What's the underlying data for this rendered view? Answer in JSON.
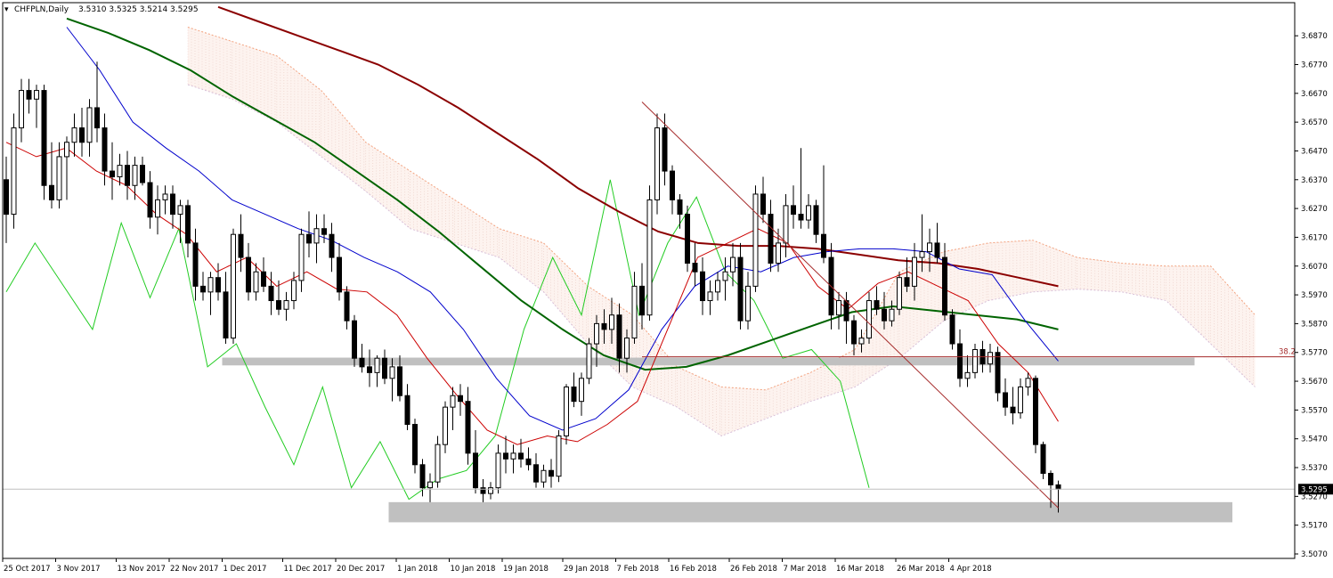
{
  "window": {
    "symbol_label": "CHFPLN,Daily",
    "ohlc_label": "3.5310 3.5325 3.5214 3.5295"
  },
  "colors": {
    "background": "#ffffff",
    "bull_candle": "#ffffff",
    "bear_candle": "#000000",
    "tenkan": "#cc0000",
    "kijun": "#0000cc",
    "chikou": "#22cc22",
    "ema50": "#006400",
    "ema100": "#8b0000",
    "cloud_top": "#f4a582",
    "cloud_bottom": "#d8bfd8",
    "support_zone": "#c0c0c0",
    "trendline": "#a52a2a",
    "fib_line": "#a52a2a",
    "price_tag_bg": "#000000",
    "price_tag_text": "#ffffff"
  },
  "chart_data": {
    "type": "candlestick",
    "ylim": [
      3.507,
      3.692
    ],
    "y_ticks": [
      "3.6870",
      "3.6770",
      "3.6670",
      "3.6570",
      "3.6470",
      "3.6370",
      "3.6270",
      "3.6170",
      "3.6070",
      "3.5970",
      "3.5870",
      "3.5770",
      "3.5670",
      "3.5570",
      "3.5470",
      "3.5370",
      "3.5270",
      "3.5170",
      "3.5070"
    ],
    "x_ticks": [
      "25 Oct 2017",
      "3 Nov 2017",
      "13 Nov 2017",
      "22 Nov 2017",
      "1 Dec 2017",
      "11 Dec 2017",
      "20 Dec 2017",
      "1 Jan 2018",
      "10 Jan 2018",
      "19 Jan 2018",
      "29 Jan 2018",
      "7 Feb 2018",
      "16 Feb 2018",
      "26 Feb 2018",
      "7 Mar 2018",
      "16 Mar 2018",
      "26 Mar 2018",
      "4 Apr 2018"
    ],
    "x_tick_index": [
      0,
      7,
      15,
      22,
      29,
      37,
      44,
      52,
      59,
      66,
      74,
      81,
      88,
      96,
      103,
      110,
      118,
      125
    ],
    "last_price": "3.5295",
    "fib_label": "38.2",
    "fib_level": 3.5755,
    "candles": [
      [
        3.637,
        3.645,
        3.615,
        3.625
      ],
      [
        3.625,
        3.66,
        3.62,
        3.655
      ],
      [
        3.655,
        3.672,
        3.65,
        3.668
      ],
      [
        3.668,
        3.672,
        3.66,
        3.665
      ],
      [
        3.665,
        3.67,
        3.655,
        3.668
      ],
      [
        3.668,
        3.67,
        3.63,
        3.635
      ],
      [
        3.635,
        3.65,
        3.627,
        3.63
      ],
      [
        3.63,
        3.65,
        3.627,
        3.645
      ],
      [
        3.645,
        3.652,
        3.63,
        3.65
      ],
      [
        3.65,
        3.66,
        3.645,
        3.655
      ],
      [
        3.655,
        3.662,
        3.645,
        3.65
      ],
      [
        3.65,
        3.665,
        3.645,
        3.662
      ],
      [
        3.662,
        3.678,
        3.65,
        3.655
      ],
      [
        3.655,
        3.66,
        3.635,
        3.64
      ],
      [
        3.64,
        3.65,
        3.63,
        3.638
      ],
      [
        3.638,
        3.646,
        3.635,
        3.642
      ],
      [
        3.642,
        3.647,
        3.63,
        3.635
      ],
      [
        3.635,
        3.645,
        3.63,
        3.642
      ],
      [
        3.642,
        3.645,
        3.635,
        3.636
      ],
      [
        3.636,
        3.64,
        3.62,
        3.624
      ],
      [
        3.624,
        3.635,
        3.618,
        3.63
      ],
      [
        3.63,
        3.635,
        3.625,
        3.632
      ],
      [
        3.632,
        3.635,
        3.62,
        3.625
      ],
      [
        3.625,
        3.63,
        3.615,
        3.628
      ],
      [
        3.628,
        3.63,
        3.61,
        3.615
      ],
      [
        3.615,
        3.62,
        3.595,
        3.6
      ],
      [
        3.6,
        3.605,
        3.595,
        3.598
      ],
      [
        3.598,
        3.605,
        3.59,
        3.603
      ],
      [
        3.603,
        3.608,
        3.595,
        3.598
      ],
      [
        3.598,
        3.605,
        3.58,
        3.582
      ],
      [
        3.582,
        3.62,
        3.58,
        3.618
      ],
      [
        3.618,
        3.625,
        3.605,
        3.61
      ],
      [
        3.61,
        3.615,
        3.595,
        3.598
      ],
      [
        3.598,
        3.608,
        3.595,
        3.605
      ],
      [
        3.605,
        3.61,
        3.598,
        3.6
      ],
      [
        3.6,
        3.605,
        3.59,
        3.595
      ],
      [
        3.595,
        3.602,
        3.59,
        3.592
      ],
      [
        3.592,
        3.598,
        3.588,
        3.595
      ],
      [
        3.595,
        3.605,
        3.592,
        3.602
      ],
      [
        3.602,
        3.62,
        3.598,
        3.618
      ],
      [
        3.618,
        3.626,
        3.61,
        3.615
      ],
      [
        3.615,
        3.625,
        3.608,
        3.62
      ],
      [
        3.62,
        3.625,
        3.615,
        3.618
      ],
      [
        3.618,
        3.622,
        3.605,
        3.61
      ],
      [
        3.61,
        3.615,
        3.595,
        3.598
      ],
      [
        3.598,
        3.6,
        3.585,
        3.588
      ],
      [
        3.588,
        3.59,
        3.572,
        3.575
      ],
      [
        3.575,
        3.58,
        3.57,
        3.572
      ],
      [
        3.572,
        3.578,
        3.565,
        3.57
      ],
      [
        3.57,
        3.576,
        3.565,
        3.575
      ],
      [
        3.575,
        3.578,
        3.566,
        3.568
      ],
      [
        3.568,
        3.575,
        3.56,
        3.572
      ],
      [
        3.572,
        3.576,
        3.56,
        3.562
      ],
      [
        3.562,
        3.566,
        3.55,
        3.552
      ],
      [
        3.552,
        3.554,
        3.535,
        3.538
      ],
      [
        3.538,
        3.54,
        3.527,
        3.53
      ],
      [
        3.53,
        3.535,
        3.525,
        3.532
      ],
      [
        3.532,
        3.548,
        3.53,
        3.545
      ],
      [
        3.545,
        3.56,
        3.542,
        3.558
      ],
      [
        3.558,
        3.565,
        3.55,
        3.562
      ],
      [
        3.562,
        3.566,
        3.555,
        3.56
      ],
      [
        3.56,
        3.565,
        3.538,
        3.542
      ],
      [
        3.542,
        3.55,
        3.528,
        3.53
      ],
      [
        3.53,
        3.533,
        3.525,
        3.528
      ],
      [
        3.528,
        3.532,
        3.526,
        3.53
      ],
      [
        3.53,
        3.545,
        3.528,
        3.542
      ],
      [
        3.542,
        3.548,
        3.535,
        3.54
      ],
      [
        3.54,
        3.545,
        3.535,
        3.542
      ],
      [
        3.542,
        3.547,
        3.537,
        3.54
      ],
      [
        3.54,
        3.544,
        3.536,
        3.538
      ],
      [
        3.538,
        3.542,
        3.53,
        3.532
      ],
      [
        3.532,
        3.538,
        3.53,
        3.536
      ],
      [
        3.536,
        3.54,
        3.53,
        3.534
      ],
      [
        3.534,
        3.55,
        3.532,
        3.548
      ],
      [
        3.548,
        3.566,
        3.545,
        3.565
      ],
      [
        3.565,
        3.57,
        3.558,
        3.56
      ],
      [
        3.56,
        3.57,
        3.555,
        3.568
      ],
      [
        3.568,
        3.582,
        3.566,
        3.58
      ],
      [
        3.58,
        3.59,
        3.572,
        3.587
      ],
      [
        3.587,
        3.592,
        3.58,
        3.585
      ],
      [
        3.585,
        3.596,
        3.58,
        3.59
      ],
      [
        3.59,
        3.594,
        3.57,
        3.575
      ],
      [
        3.575,
        3.585,
        3.57,
        3.582
      ],
      [
        3.582,
        3.605,
        3.58,
        3.6
      ],
      [
        3.6,
        3.608,
        3.585,
        3.59
      ],
      [
        3.59,
        3.635,
        3.588,
        3.63
      ],
      [
        3.63,
        3.66,
        3.625,
        3.655
      ],
      [
        3.655,
        3.66,
        3.635,
        3.64
      ],
      [
        3.64,
        3.642,
        3.625,
        3.63
      ],
      [
        3.63,
        3.632,
        3.62,
        3.625
      ],
      [
        3.625,
        3.628,
        3.605,
        3.608
      ],
      [
        3.608,
        3.615,
        3.6,
        3.605
      ],
      [
        3.605,
        3.61,
        3.59,
        3.595
      ],
      [
        3.595,
        3.602,
        3.59,
        3.598
      ],
      [
        3.598,
        3.605,
        3.595,
        3.602
      ],
      [
        3.602,
        3.61,
        3.595,
        3.605
      ],
      [
        3.605,
        3.615,
        3.6,
        3.61
      ],
      [
        3.61,
        3.615,
        3.585,
        3.588
      ],
      [
        3.588,
        3.605,
        3.585,
        3.6
      ],
      [
        3.6,
        3.635,
        3.598,
        3.632
      ],
      [
        3.632,
        3.638,
        3.622,
        3.625
      ],
      [
        3.625,
        3.63,
        3.605,
        3.608
      ],
      [
        3.608,
        3.62,
        3.605,
        3.615
      ],
      [
        3.615,
        3.632,
        3.61,
        3.628
      ],
      [
        3.628,
        3.635,
        3.62,
        3.625
      ],
      [
        3.625,
        3.648,
        3.62,
        3.623
      ],
      [
        3.623,
        3.632,
        3.62,
        3.628
      ],
      [
        3.628,
        3.63,
        3.615,
        3.618
      ],
      [
        3.618,
        3.642,
        3.608,
        3.61
      ],
      [
        3.61,
        3.615,
        3.585,
        3.59
      ],
      [
        3.59,
        3.598,
        3.585,
        3.595
      ],
      [
        3.595,
        3.598,
        3.58,
        3.588
      ],
      [
        3.588,
        3.59,
        3.576,
        3.58
      ],
      [
        3.58,
        3.585,
        3.577,
        3.582
      ],
      [
        3.582,
        3.598,
        3.58,
        3.595
      ],
      [
        3.595,
        3.6,
        3.59,
        3.592
      ],
      [
        3.592,
        3.598,
        3.585,
        3.588
      ],
      [
        3.588,
        3.595,
        3.586,
        3.592
      ],
      [
        3.592,
        3.605,
        3.59,
        3.603
      ],
      [
        3.603,
        3.61,
        3.598,
        3.6
      ],
      [
        3.6,
        3.615,
        3.595,
        3.61
      ],
      [
        3.61,
        3.625,
        3.605,
        3.612
      ],
      [
        3.612,
        3.62,
        3.605,
        3.615
      ],
      [
        3.615,
        3.622,
        3.608,
        3.61
      ],
      [
        3.61,
        3.615,
        3.588,
        3.59
      ],
      [
        3.59,
        3.592,
        3.578,
        3.58
      ],
      [
        3.58,
        3.585,
        3.565,
        3.568
      ],
      [
        3.568,
        3.576,
        3.565,
        3.57
      ],
      [
        3.57,
        3.58,
        3.568,
        3.578
      ],
      [
        3.578,
        3.581,
        3.57,
        3.573
      ],
      [
        3.573,
        3.58,
        3.57,
        3.577
      ],
      [
        3.577,
        3.579,
        3.56,
        3.563
      ],
      [
        3.563,
        3.568,
        3.555,
        3.558
      ],
      [
        3.558,
        3.565,
        3.552,
        3.556
      ],
      [
        3.556,
        3.568,
        3.554,
        3.565
      ],
      [
        3.565,
        3.57,
        3.562,
        3.568
      ],
      [
        3.568,
        3.569,
        3.542,
        3.545
      ],
      [
        3.545,
        3.546,
        3.533,
        3.535
      ],
      [
        3.535,
        3.536,
        3.523,
        3.531
      ],
      [
        3.531,
        3.5325,
        3.5214,
        3.5295
      ]
    ],
    "ema50": [
      3.693,
      3.688,
      3.682,
      3.675,
      3.666,
      3.658,
      3.65,
      3.64,
      3.63,
      3.619,
      3.607,
      3.595,
      3.585,
      3.576,
      3.571,
      3.572,
      3.576,
      3.581,
      3.586,
      3.591,
      3.593,
      3.5915,
      3.59,
      3.5885,
      3.585
    ],
    "ema100": [
      3.697,
      3.692,
      3.687,
      3.682,
      3.677,
      3.67,
      3.662,
      3.653,
      3.644,
      3.634,
      3.626,
      3.619,
      3.615,
      3.614,
      3.614,
      3.613,
      3.611,
      3.609,
      3.608,
      3.606,
      3.603,
      3.6
    ],
    "tenkan": [
      3.65,
      3.645,
      3.648,
      3.64,
      3.635,
      3.625,
      3.618,
      3.605,
      3.61,
      3.6,
      3.605,
      3.599,
      3.598,
      3.59,
      3.575,
      3.562,
      3.55,
      3.545,
      3.548,
      3.546,
      3.552,
      3.56,
      3.585,
      3.61,
      3.615,
      3.62,
      3.615,
      3.6,
      3.592,
      3.601,
      3.605,
      3.6,
      3.595,
      3.58,
      3.57,
      3.553
    ],
    "kijun": [
      3.69,
      3.675,
      3.657,
      3.648,
      3.64,
      3.63,
      3.625,
      3.62,
      3.616,
      3.61,
      3.605,
      3.598,
      3.585,
      3.568,
      3.555,
      3.55,
      3.554,
      3.564,
      3.585,
      3.6,
      3.607,
      3.605,
      3.61,
      3.612,
      3.613,
      3.613,
      3.612,
      3.606,
      3.604,
      3.588,
      3.574
    ],
    "chikou": [
      3.598,
      3.615,
      3.6,
      3.585,
      3.622,
      3.596,
      3.62,
      3.572,
      3.58,
      3.558,
      3.538,
      3.565,
      3.53,
      3.546,
      3.526,
      3.533,
      3.536,
      3.548,
      3.585,
      3.61,
      3.59,
      3.637,
      3.59,
      3.615,
      3.631,
      3.605,
      3.595,
      3.575,
      3.578,
      3.567,
      3.53
    ],
    "cloud": [
      [
        3.67,
        3.69
      ],
      [
        3.665,
        3.685
      ],
      [
        3.657,
        3.68
      ],
      [
        3.645,
        3.668
      ],
      [
        3.633,
        3.65
      ],
      [
        3.62,
        3.64
      ],
      [
        3.615,
        3.63
      ],
      [
        3.61,
        3.62
      ],
      [
        3.598,
        3.615
      ],
      [
        3.58,
        3.6
      ],
      [
        3.565,
        3.59
      ],
      [
        3.558,
        3.572
      ],
      [
        3.548,
        3.565
      ],
      [
        3.554,
        3.564
      ],
      [
        3.56,
        3.57
      ],
      [
        3.565,
        3.578
      ],
      [
        3.575,
        3.605
      ],
      [
        3.588,
        3.612
      ],
      [
        3.595,
        3.615
      ],
      [
        3.598,
        3.616
      ],
      [
        3.599,
        3.61
      ],
      [
        3.598,
        3.608
      ],
      [
        3.595,
        3.607
      ],
      [
        3.58,
        3.607
      ],
      [
        3.565,
        3.59
      ]
    ],
    "support_zones": [
      [
        3.5752,
        3.5725
      ],
      [
        3.525,
        3.518
      ]
    ],
    "trendline": [
      [
        3.664
      ],
      [
        3.523
      ]
    ]
  }
}
